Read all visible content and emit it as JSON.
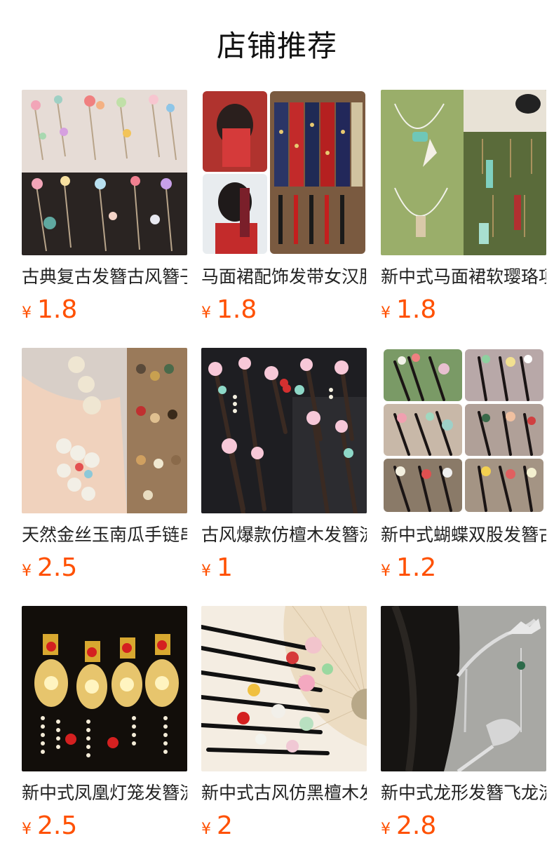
{
  "section": {
    "title": "店铺推荐"
  },
  "currency_symbol": "¥",
  "colors": {
    "price": "#ff5000"
  },
  "products": [
    {
      "name": "古典复古发簪古风簪子",
      "price": "1.8",
      "image": "floral-hairpins-collage"
    },
    {
      "name": "马面裙配饰发带女汉服",
      "price": "1.8",
      "image": "red-ribbon-hairband"
    },
    {
      "name": "新中式马面裙软璎珞项链",
      "price": "1.8",
      "image": "jade-tassel-pendants"
    },
    {
      "name": "天然金丝玉南瓜手链串",
      "price": "2.5",
      "image": "jade-bead-bracelets"
    },
    {
      "name": "古风爆款仿檀木发簪流苏",
      "price": "1",
      "image": "pink-flower-hairsticks"
    },
    {
      "name": "新中式蝴蝶双股发簪古风",
      "price": "1.2",
      "image": "butterfly-double-hairpins"
    },
    {
      "name": "新中式凤凰灯笼发簪流苏",
      "price": "2.5",
      "image": "phoenix-lantern-hairpins"
    },
    {
      "name": "新中式古风仿黑檀木发簪",
      "price": "2",
      "image": "black-hairsticks-fan"
    },
    {
      "name": "新中式龙形发簪飞龙流苏",
      "price": "2.8",
      "image": "dragon-hairpin"
    }
  ]
}
